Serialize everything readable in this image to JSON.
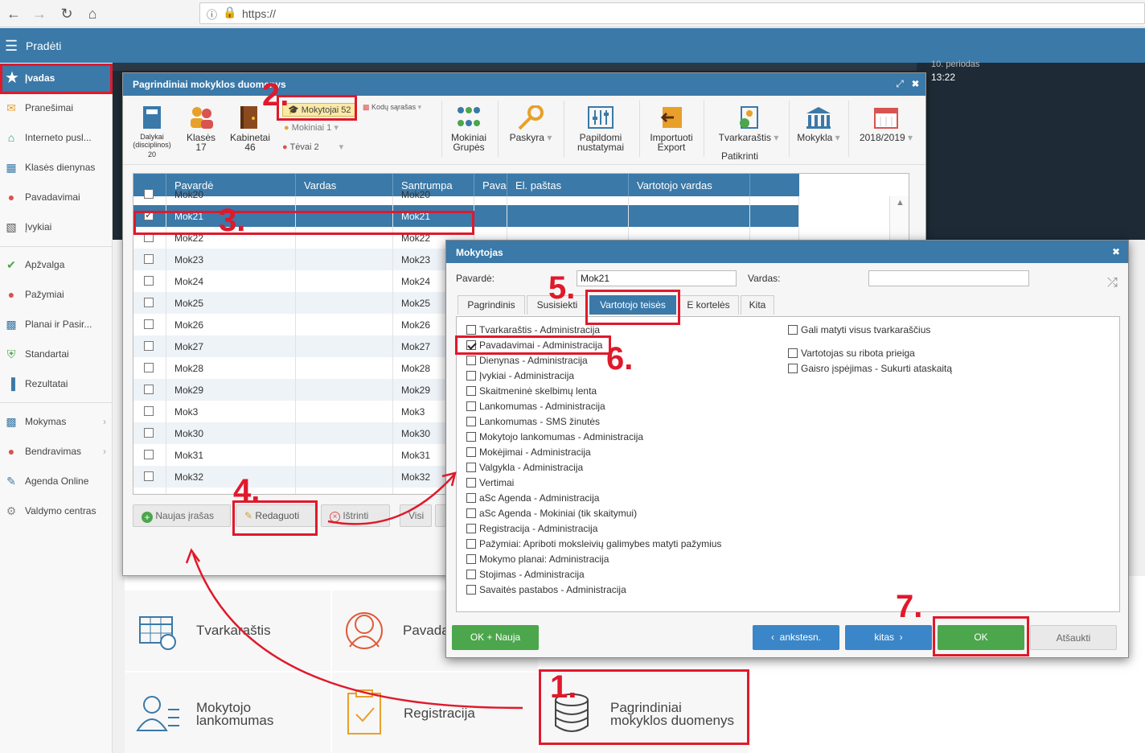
{
  "browser": {
    "url": "https://"
  },
  "topbar": {
    "title": "Pradėti"
  },
  "sidebar": {
    "items": [
      {
        "label": "Įvadas"
      },
      {
        "label": "Pranešimai"
      },
      {
        "label": "Interneto pusl..."
      },
      {
        "label": "Klasės dienynas"
      },
      {
        "label": "Pavadavimai"
      },
      {
        "label": "Įvykiai"
      },
      {
        "label": "Apžvalga"
      },
      {
        "label": "Pažymiai"
      },
      {
        "label": "Planai ir Pasir..."
      },
      {
        "label": "Standartai"
      },
      {
        "label": "Rezultatai"
      },
      {
        "label": "Mokymas"
      },
      {
        "label": "Bendravimas"
      },
      {
        "label": "Agenda Online"
      },
      {
        "label": "Valdymo centras"
      }
    ]
  },
  "timebar": {
    "period": "10. periodas",
    "time": "13:22"
  },
  "main_window": {
    "title": "Pagrindiniai mokyklos duomenys",
    "ribbon": {
      "dalykai": "Dalykai (disciplinos)",
      "dalykai_count": "20",
      "klases": "Klasės",
      "klases_count": "17",
      "kabinetai": "Kabinetai",
      "kabinetai_count": "46",
      "mokytojai": "Mokytojai 52",
      "mokiniai": "Mokiniai 1",
      "tevai": "Tėvai 2",
      "kodu": "Kodų sąrašas",
      "mokiniai_grupes_1": "Mokiniai",
      "mokiniai_grupes_2": "Grupės",
      "paskyra": "Paskyra",
      "papildomi_1": "Papildomi",
      "papildomi_2": "nustatymai",
      "import_1": "Importuoti",
      "import_2": "Export",
      "tvark": "Tvarkaraštis",
      "patikrinti": "Patikrinti",
      "mokykla": "Mokykla",
      "year": "2018/2019"
    },
    "grid": {
      "headers": [
        "Pavardė",
        "Vardas",
        "Santrumpa",
        "Pavad",
        "El. paštas",
        "Vartotojo vardas"
      ],
      "rows": [
        {
          "pavarde": "Mok20",
          "santrumpa": "Mok20"
        },
        {
          "pavarde": "Mok21",
          "santrumpa": "Mok21",
          "selected": true
        },
        {
          "pavarde": "Mok22",
          "santrumpa": "Mok22"
        },
        {
          "pavarde": "Mok23",
          "santrumpa": "Mok23"
        },
        {
          "pavarde": "Mok24",
          "santrumpa": "Mok24"
        },
        {
          "pavarde": "Mok25",
          "santrumpa": "Mok25"
        },
        {
          "pavarde": "Mok26",
          "santrumpa": "Mok26"
        },
        {
          "pavarde": "Mok27",
          "santrumpa": "Mok27"
        },
        {
          "pavarde": "Mok28",
          "santrumpa": "Mok28"
        },
        {
          "pavarde": "Mok29",
          "santrumpa": "Mok29"
        },
        {
          "pavarde": "Mok3",
          "santrumpa": "Mok3"
        },
        {
          "pavarde": "Mok30",
          "santrumpa": "Mok30"
        },
        {
          "pavarde": "Mok31",
          "santrumpa": "Mok31"
        },
        {
          "pavarde": "Mok32",
          "santrumpa": "Mok32"
        }
      ]
    },
    "buttons": {
      "new": "Naujas įrašas",
      "edit": "Redaguoti",
      "delete": "Ištrinti",
      "all": "Visi"
    }
  },
  "tiles": {
    "tvarkarastis": "Tvarkaraštis",
    "pavad": "Pavada",
    "mokytojo_1": "Mokytojo",
    "mokytojo_2": "lankomumas",
    "registracija": "Registracija",
    "pagr_1": "Pagrindiniai",
    "pagr_2": "mokyklos duomenys"
  },
  "dialog": {
    "title": "Mokytojas",
    "pavarde_label": "Pavardė:",
    "pavarde_value": "Mok21",
    "vardas_label": "Vardas:",
    "vardas_value": "",
    "tabs": [
      "Pagrindinis",
      "Susisiekti",
      "Vartotojo teisės",
      "E kortelės",
      "Kita"
    ],
    "perms_left": [
      {
        "label": "Tvarkaraštis - Administracija",
        "checked": false
      },
      {
        "label": "Pavadavimai - Administracija",
        "checked": true
      },
      {
        "label": "Dienynas - Administracija",
        "checked": false
      },
      {
        "label": "Įvykiai - Administracija",
        "checked": false
      },
      {
        "label": "Skaitmeninė skelbimų lenta",
        "checked": false
      },
      {
        "label": "Lankomumas - Administracija",
        "checked": false
      },
      {
        "label": "Lankomumas - SMS žinutės",
        "checked": false
      },
      {
        "label": "Mokytojo lankomumas - Administracija",
        "checked": false
      },
      {
        "label": "Mokėjimai - Administracija",
        "checked": false
      },
      {
        "label": "Valgykla - Administracija",
        "checked": false
      },
      {
        "label": "Vertimai",
        "checked": false
      },
      {
        "label": "aSc Agenda - Administracija",
        "checked": false
      },
      {
        "label": "aSc Agenda - Mokiniai (tik skaitymui)",
        "checked": false
      },
      {
        "label": "Registracija - Administracija",
        "checked": false
      },
      {
        "label": "Pažymiai: Apriboti moksleivių galimybes matyti pažymius",
        "checked": false
      },
      {
        "label": "Mokymo planai: Administracija",
        "checked": false
      },
      {
        "label": "Stojimas - Administracija",
        "checked": false
      },
      {
        "label": "Savaitės pastabos - Administracija",
        "checked": false
      }
    ],
    "perms_right": [
      {
        "label": "Gali matyti visus tvarkaraščius",
        "checked": false
      },
      {
        "label": "Vartotojas su ribota prieiga",
        "checked": false
      },
      {
        "label": "Gaisro įspėjimas - Sukurti ataskaitą",
        "checked": false
      }
    ],
    "buttons": {
      "ok_new": "OK + Nauja",
      "prev": "ankstesn.",
      "next": "kitas",
      "ok": "OK",
      "cancel": "Atšaukti"
    }
  },
  "annotations": [
    "1.",
    "2.",
    "3.",
    "4.",
    "5.",
    "6.",
    "7."
  ],
  "colors": {
    "accent": "#3a79a8",
    "green": "#4ca64c",
    "annotation": "#e0192b"
  }
}
